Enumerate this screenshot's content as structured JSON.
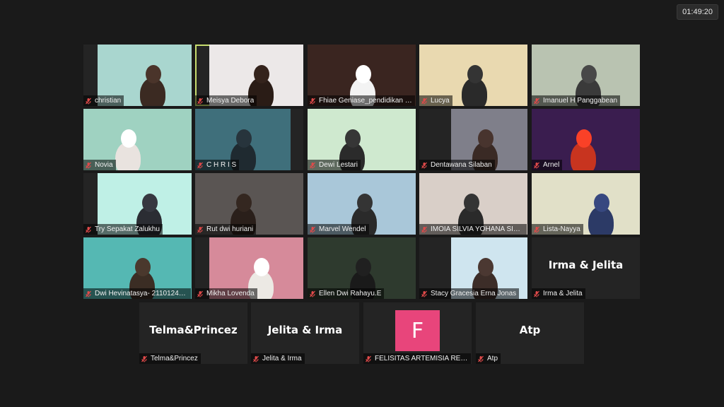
{
  "meeting": {
    "timer": "01:49:20"
  },
  "icons": {
    "muted_mic": "mic-muted-icon"
  },
  "colors": {
    "active_speaker": "#c7dd6e",
    "avatar_bg": "#e8457b",
    "muted": "#e04a4a"
  },
  "participants": [
    {
      "name": "christian"
    },
    {
      "name": "Meisya Debora"
    },
    {
      "name": "Fhiae Geniase_pendidikan ki..."
    },
    {
      "name": "Lucya"
    },
    {
      "name": "Imanuel H Panggabean"
    },
    {
      "name": "Novia"
    },
    {
      "name": "C H R I S"
    },
    {
      "name": "Dewi Lestari"
    },
    {
      "name": "Dentawana Silaban"
    },
    {
      "name": "Arnel"
    },
    {
      "name": "Try Sepakat Zalukhu"
    },
    {
      "name": "Rut dwi huriani"
    },
    {
      "name": "Marvel Wendel"
    },
    {
      "name": "IMOIA SILVIA YOHANA SIMA..."
    },
    {
      "name": "Lista-Nayya"
    },
    {
      "name": "Dwi Hevinatasya- 21101242..."
    },
    {
      "name": "Mikha Lovenda"
    },
    {
      "name": "Ellen Dwi Rahayu.E"
    },
    {
      "name": "Stacy Gracesia Erna Jonas"
    },
    {
      "name": "Irma & Jelita",
      "big": "Irma & Jelita"
    },
    {
      "name": "Telma&Princez",
      "big": "Telma&Princez"
    },
    {
      "name": "Jelita & Irma",
      "big": "Jelita & Irma"
    },
    {
      "name": "FELISITAS ARTEMISIA RERUN...",
      "avatar": "F"
    },
    {
      "name": "Atp",
      "big": "Atp"
    }
  ]
}
